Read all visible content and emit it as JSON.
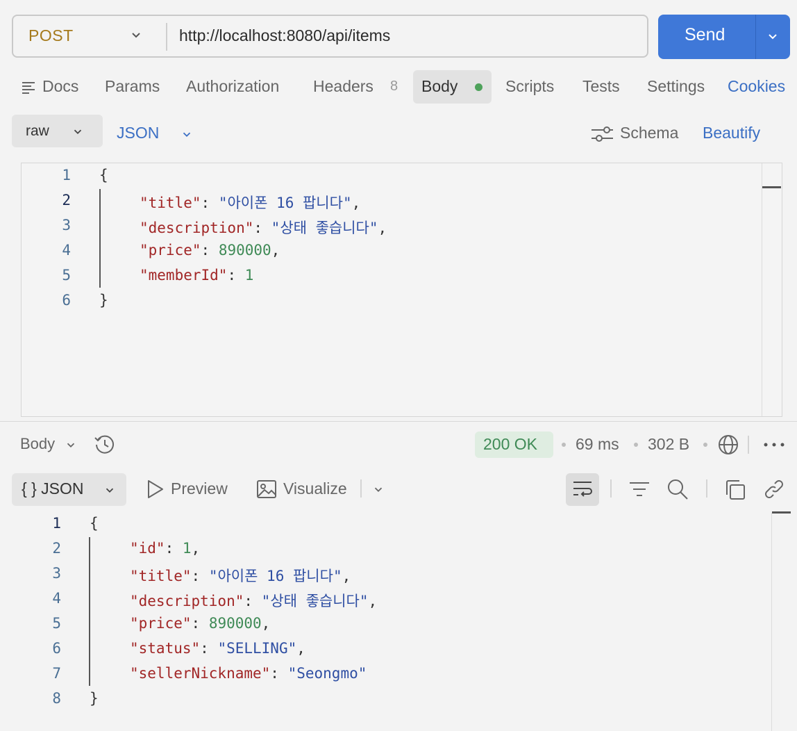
{
  "request": {
    "method": "POST",
    "url": "http://localhost:8080/api/items",
    "send_label": "Send"
  },
  "tabs": [
    {
      "label": "Docs"
    },
    {
      "label": "Params"
    },
    {
      "label": "Authorization"
    },
    {
      "label": "Headers",
      "badge": "8"
    },
    {
      "label": "Body",
      "active": true
    },
    {
      "label": "Scripts"
    },
    {
      "label": "Tests"
    },
    {
      "label": "Settings"
    },
    {
      "label": "Cookies"
    }
  ],
  "body_toolbar": {
    "mode": "raw",
    "format": "JSON",
    "schema_label": "Schema",
    "beautify_label": "Beautify"
  },
  "request_body": {
    "line_numbers": [
      "1",
      "2",
      "3",
      "4",
      "5",
      "6"
    ],
    "lines": [
      [
        {
          "t": "{",
          "c": "punc"
        }
      ],
      [
        {
          "t": "\"title\"",
          "c": "key"
        },
        {
          "t": ": ",
          "c": "punc"
        },
        {
          "t": "\"아이폰 16 팝니다\"",
          "c": "str"
        },
        {
          "t": ",",
          "c": "punc"
        }
      ],
      [
        {
          "t": "\"description\"",
          "c": "key"
        },
        {
          "t": ": ",
          "c": "punc"
        },
        {
          "t": "\"상태 좋습니다\"",
          "c": "str"
        },
        {
          "t": ",",
          "c": "punc"
        }
      ],
      [
        {
          "t": "\"price\"",
          "c": "key"
        },
        {
          "t": ": ",
          "c": "punc"
        },
        {
          "t": "890000",
          "c": "num"
        },
        {
          "t": ",",
          "c": "punc"
        }
      ],
      [
        {
          "t": "\"memberId\"",
          "c": "key"
        },
        {
          "t": ": ",
          "c": "punc"
        },
        {
          "t": "1",
          "c": "num"
        }
      ],
      [
        {
          "t": "}",
          "c": "punc"
        }
      ]
    ]
  },
  "response": {
    "section_label": "Body",
    "status": "200 OK",
    "time": "69 ms",
    "size": "302 B",
    "format": "JSON",
    "preview_label": "Preview",
    "visualize_label": "Visualize",
    "line_numbers": [
      "1",
      "2",
      "3",
      "4",
      "5",
      "6",
      "7",
      "8"
    ],
    "lines": [
      [
        {
          "t": "{",
          "c": "punc"
        }
      ],
      [
        {
          "t": "\"id\"",
          "c": "key"
        },
        {
          "t": ": ",
          "c": "punc"
        },
        {
          "t": "1",
          "c": "num"
        },
        {
          "t": ",",
          "c": "punc"
        }
      ],
      [
        {
          "t": "\"title\"",
          "c": "key"
        },
        {
          "t": ": ",
          "c": "punc"
        },
        {
          "t": "\"아이폰 16 팝니다\"",
          "c": "str"
        },
        {
          "t": ",",
          "c": "punc"
        }
      ],
      [
        {
          "t": "\"description\"",
          "c": "key"
        },
        {
          "t": ": ",
          "c": "punc"
        },
        {
          "t": "\"상태 좋습니다\"",
          "c": "str"
        },
        {
          "t": ",",
          "c": "punc"
        }
      ],
      [
        {
          "t": "\"price\"",
          "c": "key"
        },
        {
          "t": ": ",
          "c": "punc"
        },
        {
          "t": "890000",
          "c": "num"
        },
        {
          "t": ",",
          "c": "punc"
        }
      ],
      [
        {
          "t": "\"status\"",
          "c": "key"
        },
        {
          "t": ": ",
          "c": "punc"
        },
        {
          "t": "\"SELLING\"",
          "c": "str"
        },
        {
          "t": ",",
          "c": "punc"
        }
      ],
      [
        {
          "t": "\"sellerNickname\"",
          "c": "key"
        },
        {
          "t": ": ",
          "c": "punc"
        },
        {
          "t": "\"Seongmo\"",
          "c": "str"
        }
      ],
      [
        {
          "t": "}",
          "c": "punc"
        }
      ]
    ]
  },
  "colors": {
    "accent": "#3f78d8",
    "method": "#a57a1c",
    "status_ok": "#3f8a56",
    "json_key": "#a12626",
    "json_string": "#2f4fa3",
    "json_number": "#3f8a56"
  }
}
